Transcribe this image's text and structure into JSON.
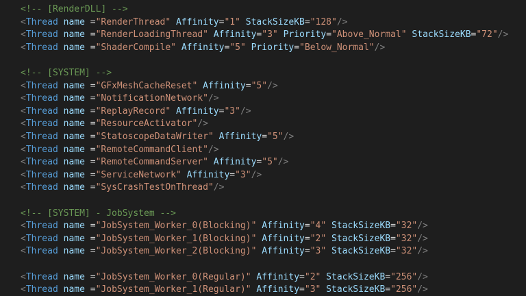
{
  "editor": {
    "colors": {
      "background": "#1e1e1e",
      "comment": "#6a9955",
      "bracket": "#808080",
      "tag": "#569cd6",
      "attribute": "#9cdcfe",
      "string": "#ce9178",
      "text": "#d4d4d4"
    },
    "lines": [
      {
        "type": "comment",
        "text": "<!-- [RenderDLL] -->"
      },
      {
        "type": "thread",
        "name": "RenderThread",
        "attrs": [
          {
            "k": "Affinity",
            "v": "1"
          },
          {
            "k": "StackSizeKB",
            "v": "128"
          }
        ]
      },
      {
        "type": "thread",
        "name": "RenderLoadingThread",
        "attrs": [
          {
            "k": "Affinity",
            "v": "3"
          },
          {
            "k": "Priority",
            "v": "Above_Normal"
          },
          {
            "k": "StackSizeKB",
            "v": "72"
          }
        ]
      },
      {
        "type": "thread",
        "name": "ShaderCompile",
        "attrs": [
          {
            "k": "Affinity",
            "v": "5"
          },
          {
            "k": "Priority",
            "v": "Below_Normal"
          }
        ]
      },
      {
        "type": "blank"
      },
      {
        "type": "comment",
        "text": "<!-- [SYSTEM] -->"
      },
      {
        "type": "thread",
        "name": "GFxMeshCacheReset",
        "attrs": [
          {
            "k": "Affinity",
            "v": "5"
          }
        ]
      },
      {
        "type": "thread",
        "name": "NotificationNetwork",
        "attrs": []
      },
      {
        "type": "thread",
        "name": "ReplayRecord",
        "attrs": [
          {
            "k": "Affinity",
            "v": "3"
          }
        ]
      },
      {
        "type": "thread",
        "name": "ResourceActivator",
        "attrs": []
      },
      {
        "type": "thread",
        "name": "StatoscopeDataWriter",
        "attrs": [
          {
            "k": "Affinity",
            "v": "5"
          }
        ]
      },
      {
        "type": "thread",
        "name": "RemoteCommandClient",
        "attrs": []
      },
      {
        "type": "thread",
        "name": "RemoteCommandServer",
        "attrs": [
          {
            "k": "Affinity",
            "v": "5"
          }
        ]
      },
      {
        "type": "thread",
        "name": "ServiceNetwork",
        "attrs": [
          {
            "k": "Affinity",
            "v": "3"
          }
        ]
      },
      {
        "type": "thread",
        "name": "SysCrashTestOnThread",
        "attrs": []
      },
      {
        "type": "blank"
      },
      {
        "type": "comment",
        "text": "<!-- [SYSTEM] - JobSystem -->"
      },
      {
        "type": "thread",
        "name": "JobSystem_Worker_0(Blocking)",
        "attrs": [
          {
            "k": "Affinity",
            "v": "4"
          },
          {
            "k": "StackSizeKB",
            "v": "32"
          }
        ]
      },
      {
        "type": "thread",
        "name": "JobSystem_Worker_1(Blocking)",
        "attrs": [
          {
            "k": "Affinity",
            "v": "2"
          },
          {
            "k": "StackSizeKB",
            "v": "32"
          }
        ]
      },
      {
        "type": "thread",
        "name": "JobSystem_Worker_2(Blocking)",
        "attrs": [
          {
            "k": "Affinity",
            "v": "3"
          },
          {
            "k": "StackSizeKB",
            "v": "32"
          }
        ]
      },
      {
        "type": "blank"
      },
      {
        "type": "thread",
        "name": "JobSystem_Worker_0(Regular)",
        "attrs": [
          {
            "k": "Affinity",
            "v": "2"
          },
          {
            "k": "StackSizeKB",
            "v": "256"
          }
        ]
      },
      {
        "type": "thread",
        "name": "JobSystem_Worker_1(Regular)",
        "attrs": [
          {
            "k": "Affinity",
            "v": "3"
          },
          {
            "k": "StackSizeKB",
            "v": "256"
          }
        ]
      }
    ]
  }
}
